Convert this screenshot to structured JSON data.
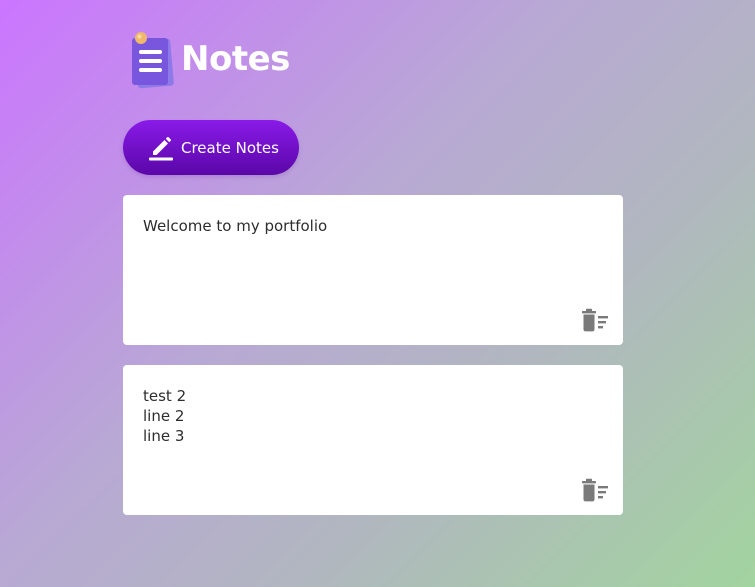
{
  "app": {
    "title": "Notes",
    "logo_icon": "notes-logo-icon"
  },
  "toolbar": {
    "create_label": "Create Notes",
    "create_icon": "pencil-icon"
  },
  "notes": [
    {
      "text": "Welcome to my portfolio",
      "delete_icon": "delete-sweep-icon"
    },
    {
      "text": "test 2\nline 2\nline 3",
      "delete_icon": "delete-sweep-icon"
    }
  ],
  "colors": {
    "accent": "#7a12d4",
    "card": "#ffffff",
    "text": "#2d2d2d",
    "icon": "#7a7a7a"
  }
}
